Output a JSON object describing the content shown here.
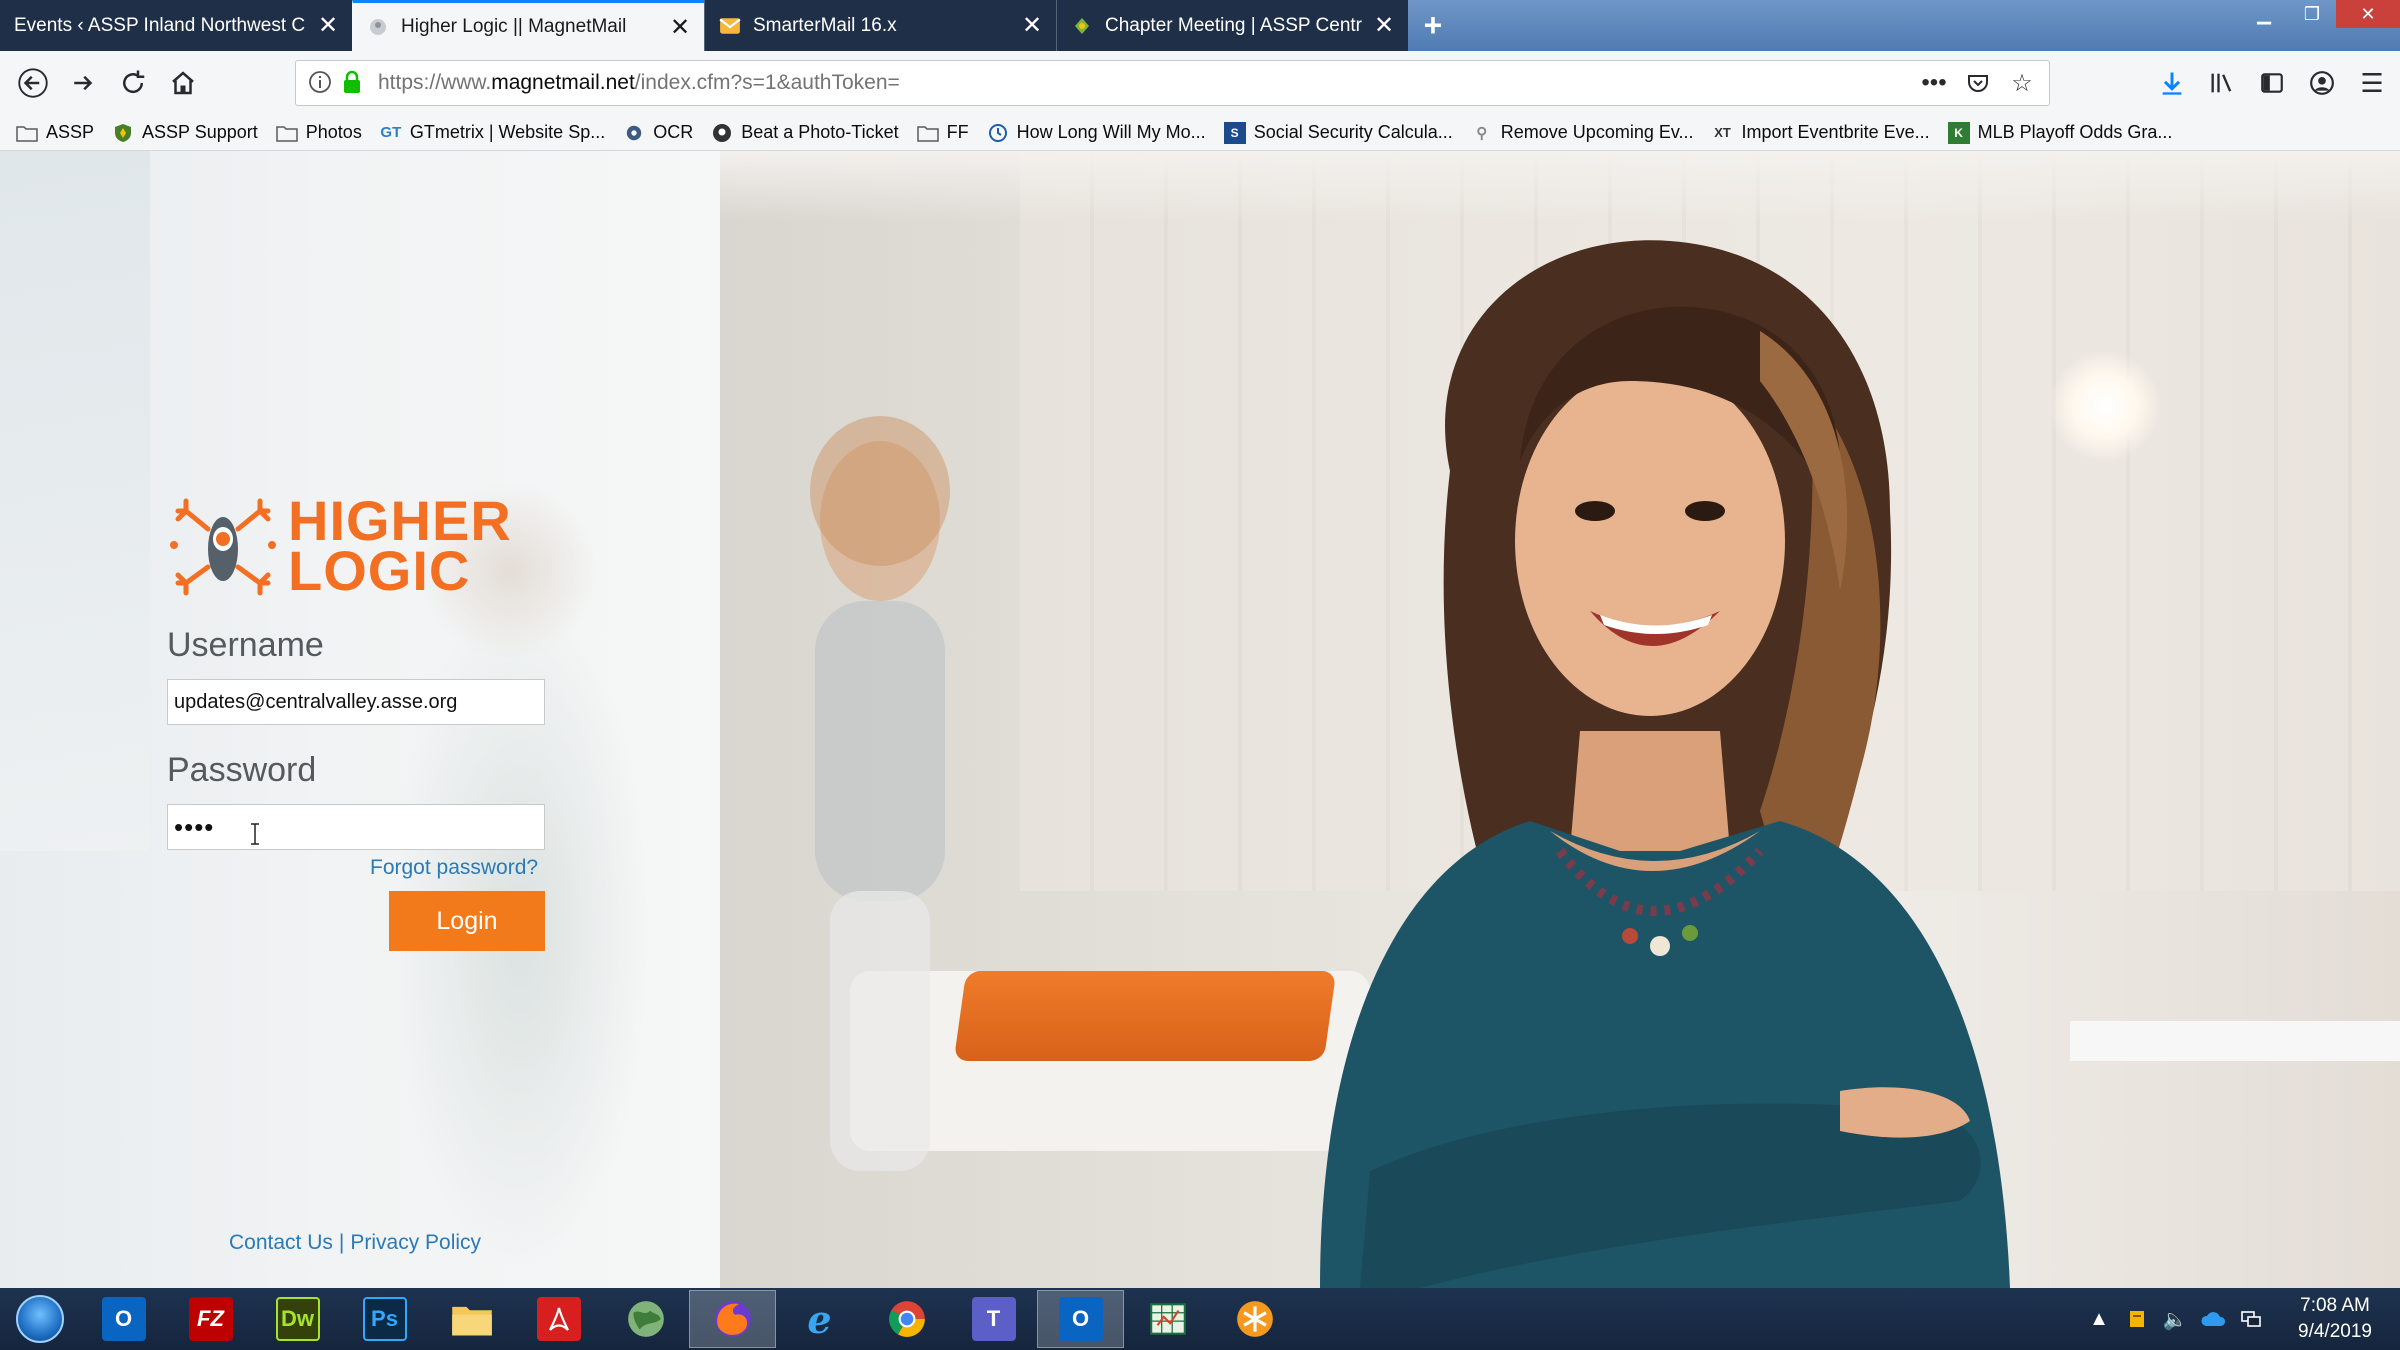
{
  "browser": {
    "tabs": [
      {
        "title": "Events ‹ ASSP Inland Northwest Cha",
        "favicon": "none"
      },
      {
        "title": "Higher Logic || MagnetMail",
        "favicon": "higher-logic-favicon",
        "active": true
      },
      {
        "title": "SmarterMail 16.x",
        "favicon": "mail-envelope-favicon"
      },
      {
        "title": "Chapter Meeting | ASSP Centra",
        "favicon": "assp-leaf-favicon"
      }
    ],
    "url_prefix": "https://www.",
    "url_domain": "magnetmail.net",
    "url_path": "/index.cfm?s=1&authToken=",
    "bookmarks": [
      {
        "label": "ASSP",
        "icon": "folder-icon"
      },
      {
        "label": "ASSP Support",
        "icon": "assp-shield-icon"
      },
      {
        "label": "Photos",
        "icon": "folder-icon"
      },
      {
        "label": "GTmetrix | Website Sp...",
        "icon": "gtmetrix-icon"
      },
      {
        "label": "OCR",
        "icon": "ocr-icon"
      },
      {
        "label": "Beat a Photo-Ticket",
        "icon": "photo-ticket-icon"
      },
      {
        "label": "FF",
        "icon": "folder-icon"
      },
      {
        "label": "How Long Will My Mo...",
        "icon": "globe-icon"
      },
      {
        "label": "Social Security Calcula...",
        "icon": "social-security-icon"
      },
      {
        "label": "Remove Upcoming Ev...",
        "icon": "wordpress-icon"
      },
      {
        "label": "Import Eventbrite Eve...",
        "icon": "xt-icon"
      },
      {
        "label": "MLB Playoff Odds Gra...",
        "icon": "mlb-icon"
      }
    ]
  },
  "login": {
    "logo_line1": "HIGHER",
    "logo_line2": "LOGIC",
    "username_label": "Username",
    "username_value": "updates@centralvalley.asse.org",
    "password_label": "Password",
    "password_value": "••••",
    "forgot_label": "Forgot password?",
    "login_label": "Login",
    "contact_label": "Contact Us",
    "separator": "|",
    "privacy_label": "Privacy Policy"
  },
  "colors": {
    "brand_orange": "#f36f21",
    "link_blue": "#2a7ab8",
    "button_orange": "#f27a1a"
  },
  "taskbar": {
    "apps": [
      {
        "name": "outlook-icon",
        "label": "O"
      },
      {
        "name": "filezilla-icon",
        "label": "FZ"
      },
      {
        "name": "dreamweaver-icon",
        "label": "Dw"
      },
      {
        "name": "photoshop-icon",
        "label": "Ps"
      },
      {
        "name": "file-explorer-icon",
        "label": ""
      },
      {
        "name": "acrobat-icon",
        "label": ""
      },
      {
        "name": "globe-app-icon",
        "label": ""
      },
      {
        "name": "firefox-icon",
        "label": ""
      },
      {
        "name": "internet-explorer-icon",
        "label": "e"
      },
      {
        "name": "chrome-icon",
        "label": ""
      },
      {
        "name": "teams-icon",
        "label": "T"
      },
      {
        "name": "outlook-2-icon",
        "label": "O"
      },
      {
        "name": "excel-icon",
        "label": ""
      },
      {
        "name": "snowflake-app-icon",
        "label": ""
      }
    ],
    "time": "7:08 AM",
    "date": "9/4/2019"
  }
}
